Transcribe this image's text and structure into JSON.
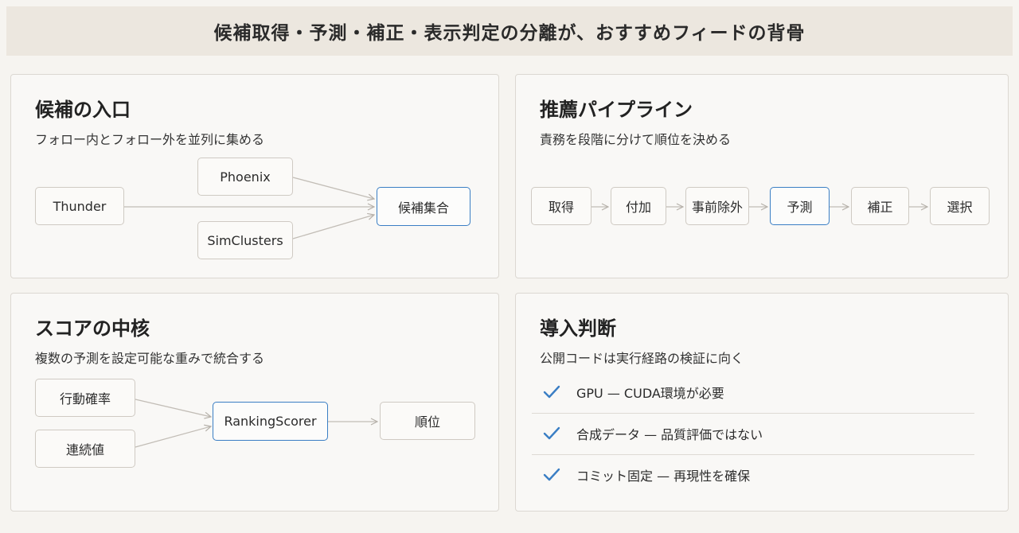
{
  "banner": {
    "title": "候補取得・予測・補正・表示判定の分離が、おすすめフィードの背骨"
  },
  "candidates": {
    "title": "候補の入口",
    "subtitle": "フォロー内とフォロー外を並列に集める",
    "nodes": {
      "thunder": "Thunder",
      "phoenix": "Phoenix",
      "simclusters": "SimClusters",
      "set": "候補集合"
    }
  },
  "pipeline": {
    "title": "推薦パイプライン",
    "subtitle": "責務を段階に分けて順位を決める",
    "steps": [
      "取得",
      "付加",
      "事前除外",
      "予測",
      "補正",
      "選択"
    ]
  },
  "score": {
    "title": "スコアの中核",
    "subtitle": "複数の予測を設定可能な重みで統合する",
    "nodes": {
      "action": "行動確率",
      "continuous": "連続値",
      "scorer": "RankingScorer",
      "rank": "順位"
    }
  },
  "adoption": {
    "title": "導入判断",
    "subtitle": "公開コードは実行経路の検証に向く",
    "items": [
      "GPU — CUDA環境が必要",
      "合成データ — 品質評価ではない",
      "コミット固定 — 再現性を確保"
    ]
  },
  "colors": {
    "accent": "#3a7ec4",
    "banner_bg": "#ece7df",
    "page_bg": "#f6f4f0"
  }
}
